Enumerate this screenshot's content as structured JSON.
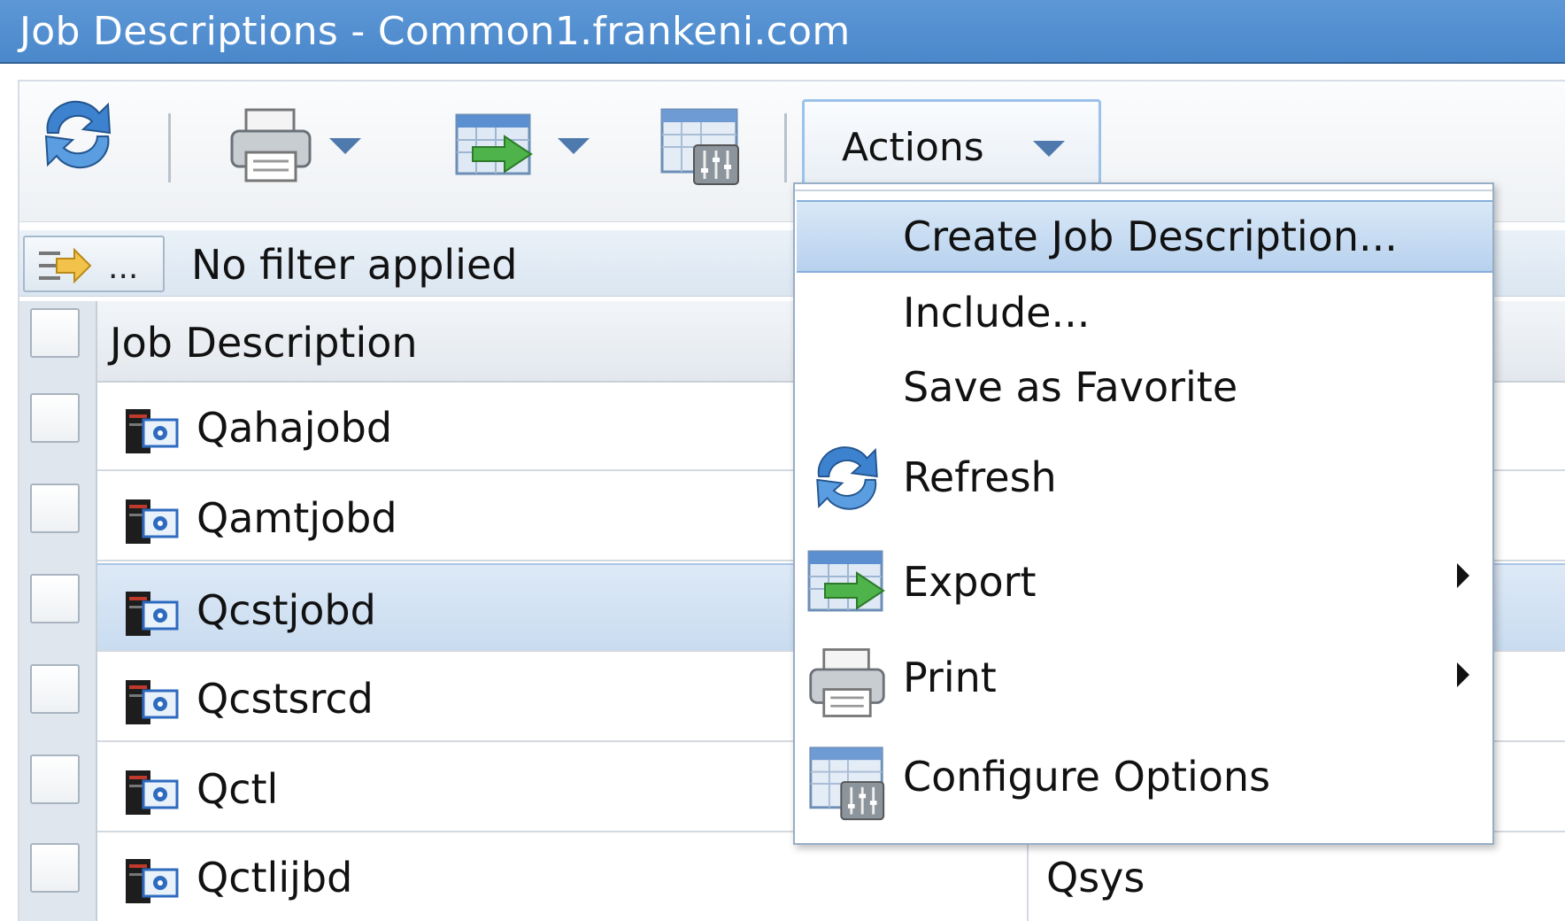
{
  "window": {
    "title": "Job Descriptions - Common1.frankeni.com"
  },
  "toolbar": {
    "refresh_icon": "refresh-icon",
    "print_icon": "print-icon",
    "export_icon": "export-icon",
    "configure_icon": "configure-options-icon",
    "actions_label": "Actions"
  },
  "filter": {
    "button_text": "...",
    "status": "No filter applied"
  },
  "table": {
    "column_header": "Job Description",
    "rows": [
      {
        "name": "Qahajobd",
        "library": ""
      },
      {
        "name": "Qamtjobd",
        "library": ""
      },
      {
        "name": "Qcstjobd",
        "library": ""
      },
      {
        "name": "Qcstsrcd",
        "library": ""
      },
      {
        "name": "Qctl",
        "library": ""
      },
      {
        "name": "Qctlijbd",
        "library": "Qsys"
      }
    ]
  },
  "menu": {
    "items": [
      {
        "label": "Create Job Description...",
        "icon": "",
        "submenu": false,
        "highlighted": true
      },
      {
        "label": "Include...",
        "icon": "",
        "submenu": false
      },
      {
        "label": "Save as Favorite",
        "icon": "",
        "submenu": false
      },
      {
        "label": "Refresh",
        "icon": "refresh-icon",
        "submenu": false
      },
      {
        "label": "Export",
        "icon": "export-icon",
        "submenu": true
      },
      {
        "label": "Print",
        "icon": "print-icon",
        "submenu": true
      },
      {
        "label": "Configure Options",
        "icon": "configure-options-icon",
        "submenu": false
      }
    ]
  },
  "colors": {
    "titlebar": "#4a88cb",
    "selection": "#c9dcf0",
    "accent": "#4e79ad"
  }
}
